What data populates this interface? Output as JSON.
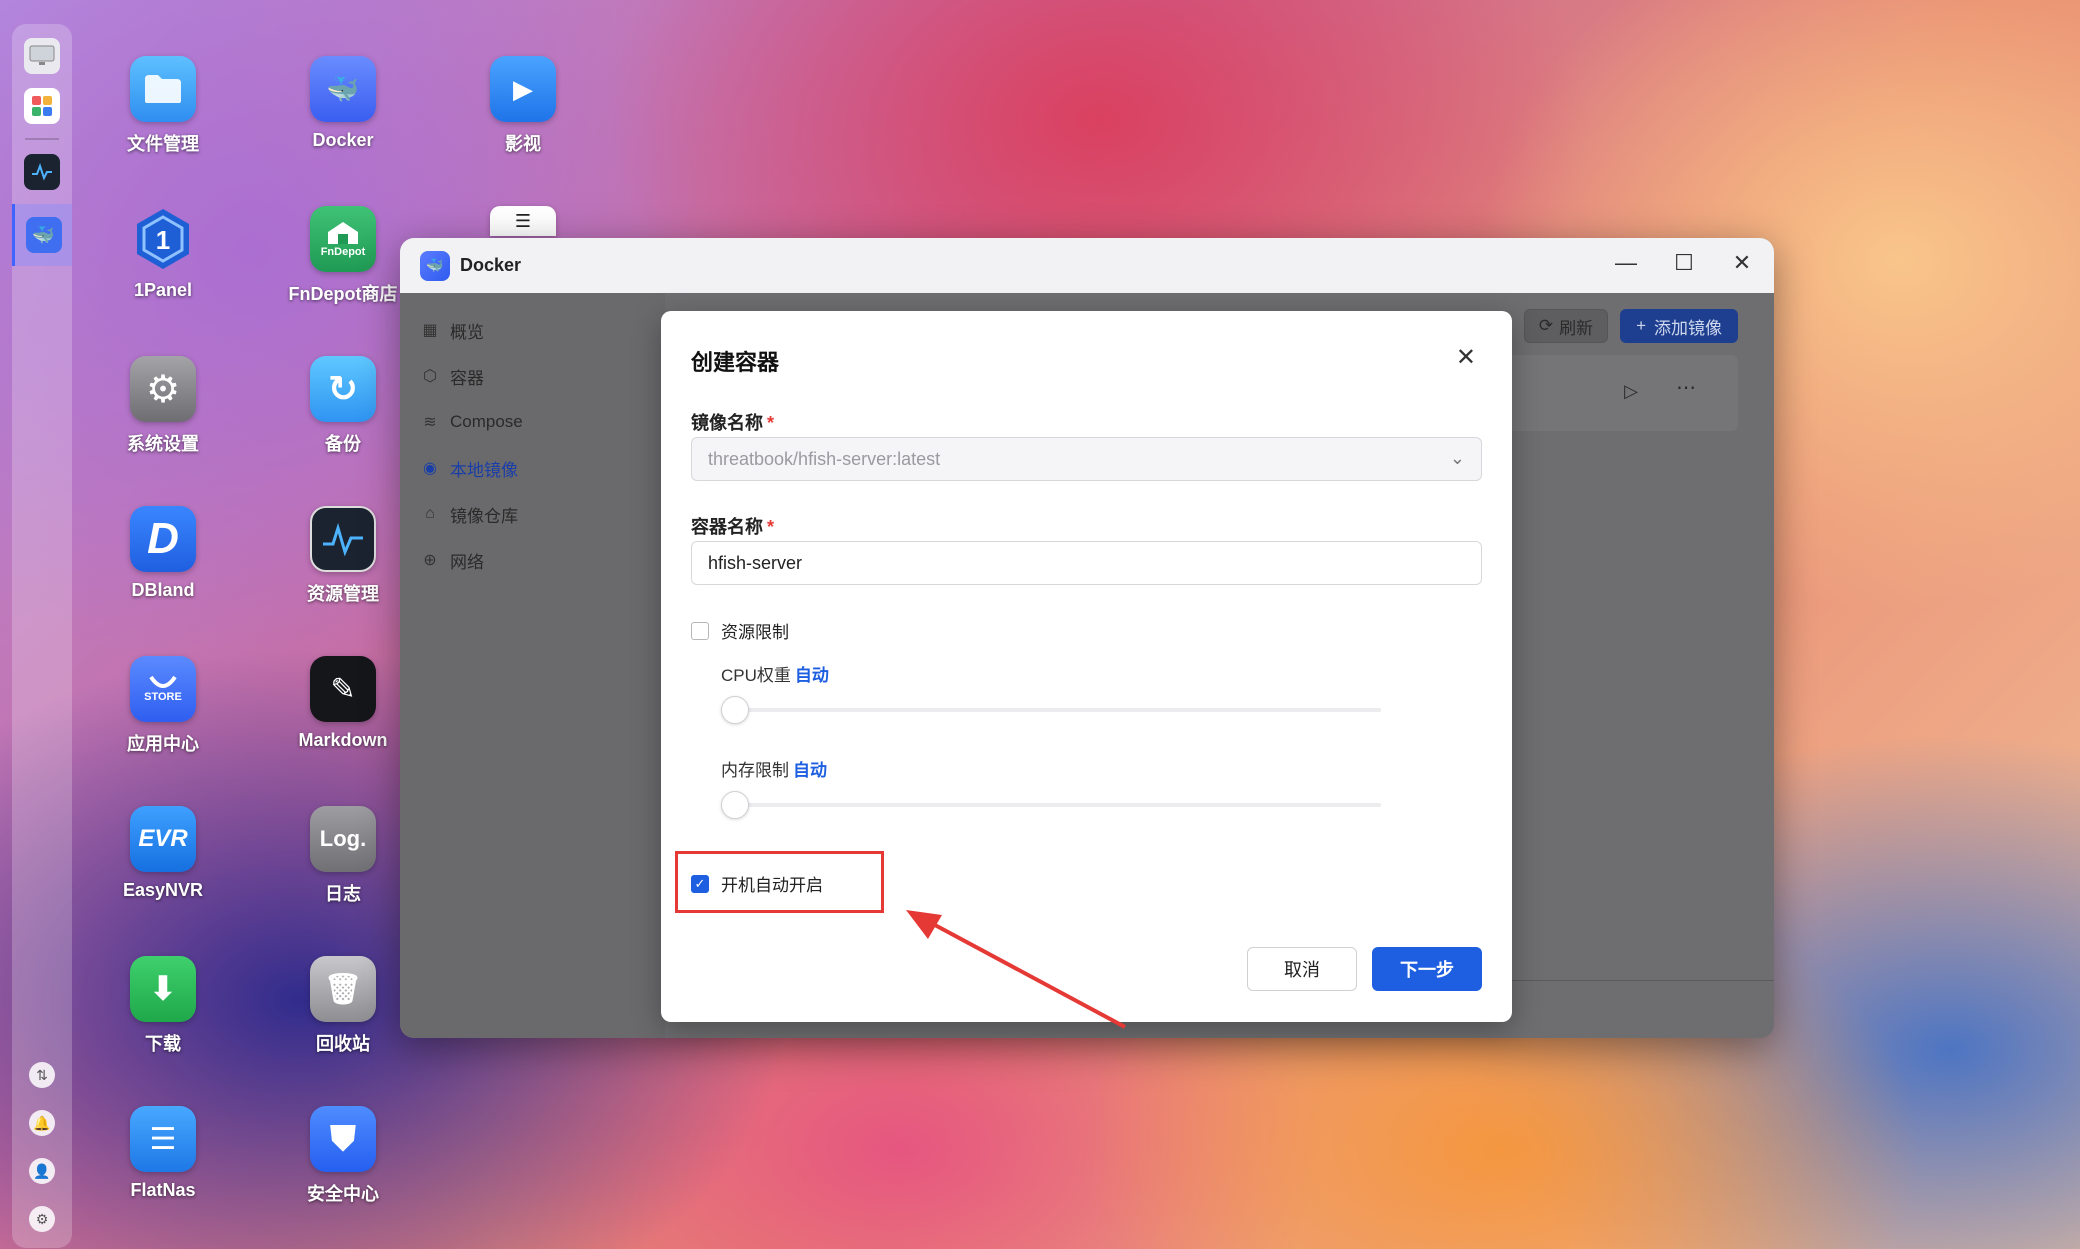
{
  "desktop": {
    "icons": [
      {
        "label": "文件管理",
        "icon": "folder-icon",
        "color": "#3aa0f2"
      },
      {
        "label": "Docker",
        "icon": "docker-icon",
        "color": "#3f6ef0"
      },
      {
        "label": "影视",
        "icon": "video-icon",
        "color": "#2f8af0"
      },
      {
        "label": "1Panel",
        "icon": "1panel-icon",
        "color": "#1e5fd6"
      },
      {
        "label": "FnDepot商店",
        "icon": "fndepot-icon",
        "color": "#2aa864"
      },
      {
        "label": "系统设置",
        "icon": "settings-icon",
        "color": "#8b8b8f"
      },
      {
        "label": "备份",
        "icon": "backup-icon",
        "color": "#3aa5f5"
      },
      {
        "label": "DBland",
        "icon": "dbland-icon",
        "color": "#1f6ff0"
      },
      {
        "label": "资源管理",
        "icon": "resource-monitor-icon",
        "color": "#1b2330"
      },
      {
        "label": "应用中心",
        "icon": "app-store-icon",
        "color": "#3b6df2"
      },
      {
        "label": "Markdown",
        "icon": "markdown-icon",
        "color": "#15161a"
      },
      {
        "label": "EasyNVR",
        "icon": "easynvr-icon",
        "color": "#1f84ea"
      },
      {
        "label": "日志",
        "icon": "log-icon",
        "color": "#8a8a8e"
      },
      {
        "label": "下载",
        "icon": "download-icon",
        "color": "#27b04f"
      },
      {
        "label": "回收站",
        "icon": "trash-icon",
        "color": "#9c9c9c"
      },
      {
        "label": "FlatNas",
        "icon": "flatnas-icon",
        "color": "#2b8be8"
      },
      {
        "label": "安全中心",
        "icon": "security-icon",
        "color": "#2f6ff0"
      }
    ],
    "tile_text": {
      "docker": "🐳",
      "video": "▶",
      "onepanel": "1",
      "fndepot": "FnDepot",
      "settings": "⚙",
      "backup": "↻",
      "dbland": "D",
      "resource": "∿",
      "store": "STORE",
      "markdown": "✎",
      "easynvr": "EVR",
      "log": "Log.",
      "download": "⬇",
      "trash": "🗑",
      "flatnas": "☰",
      "security": "⛊"
    }
  },
  "window": {
    "title": "Docker",
    "controls": {
      "minimize": "—",
      "maximize": "☐",
      "close": "✕"
    },
    "sidebar": [
      {
        "label": "概览",
        "icon": "▦"
      },
      {
        "label": "容器",
        "icon": "⬡"
      },
      {
        "label": "Compose",
        "icon": "≋"
      },
      {
        "label": "本地镜像",
        "icon": "◉",
        "active": true
      },
      {
        "label": "镜像仓库",
        "icon": "⌂"
      },
      {
        "label": "网络",
        "icon": "⊕"
      }
    ],
    "refresh_label": "刷新",
    "add_image_label": "添加镜像"
  },
  "dialog": {
    "title": "创建容器",
    "image_name_label": "镜像名称",
    "image_name_value": "threatbook/hfish-server:latest",
    "container_name_label": "容器名称",
    "container_name_value": "hfish-server",
    "resource_limit_label": "资源限制",
    "cpu_weight_label": "CPU权重",
    "cpu_auto": "自动",
    "memory_limit_label": "内存限制",
    "memory_auto": "自动",
    "autostart_label": "开机自动开启",
    "autostart_checked": true,
    "resource_limit_checked": false,
    "cancel_label": "取消",
    "next_label": "下一步",
    "required_mark": "*"
  },
  "colors": {
    "accent": "#1d5fe0",
    "annotation": "#e53935"
  }
}
